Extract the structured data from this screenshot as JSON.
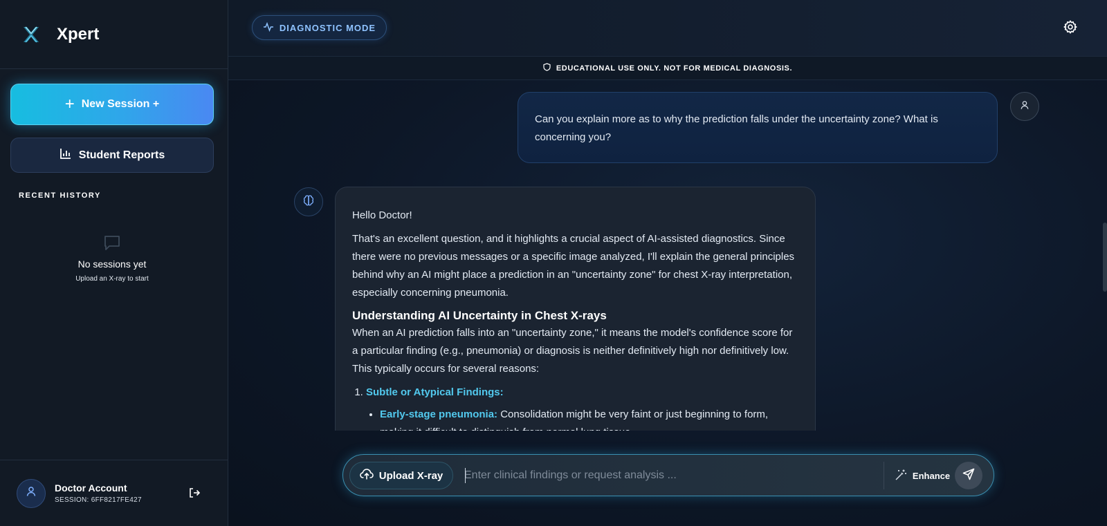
{
  "app": {
    "name": "Xpert"
  },
  "sidebar": {
    "new_session_label": "New Session +",
    "reports_label": "Student Reports",
    "recent_history_title": "RECENT HISTORY",
    "empty_title": "No sessions yet",
    "empty_subtitle": "Upload an X-ray to start"
  },
  "account": {
    "name": "Doctor Account",
    "session": "SESSION: 6FF8217FE427"
  },
  "header": {
    "mode_label": "DIAGNOSTIC MODE",
    "disclaimer": "EDUCATIONAL USE ONLY. NOT FOR MEDICAL DIAGNOSIS."
  },
  "chat": {
    "user_message": "Can you explain more as to why the prediction falls under the uncertainty zone? What is concerning you?",
    "bot": {
      "greeting": "Hello Doctor!",
      "intro": "That's an excellent question, and it highlights a crucial aspect of AI-assisted diagnostics. Since there were no previous messages or a specific image analyzed, I'll explain the general principles behind why an AI might place a prediction in an \"uncertainty zone\" for chest X-ray interpretation, especially concerning pneumonia.",
      "heading": "Understanding AI Uncertainty in Chest X-rays",
      "explanation": "When an AI prediction falls into an \"uncertainty zone,\" it means the model's confidence score for a particular finding (e.g., pneumonia) or diagnosis is neither definitively high nor definitively low. This typically occurs for several reasons:",
      "list_item_1": "Subtle or Atypical Findings:",
      "sub_item_1_label": "Early-stage pneumonia:",
      "sub_item_1_text": "Consolidation might be very faint or just beginning to form, making it difficult to distinguish from normal lung tissue."
    }
  },
  "composer": {
    "upload_label": "Upload X-ray",
    "placeholder": "Enter clinical findings or request analysis ...",
    "value": "",
    "enhance_label": "Enhance"
  },
  "colors": {
    "accent_cyan": "#52c9ee",
    "new_session_gradient_start": "#17bde0",
    "new_session_gradient_end": "#4a88f2",
    "mode_pill_text": "#8fc3ff"
  },
  "icons": {
    "logo": "x-logo-icon",
    "plus": "plus-icon",
    "reports": "bar-chart-icon",
    "empty": "chat-bubble-icon",
    "avatar": "user-icon",
    "logout": "logout-icon",
    "mode": "activity-pulse-icon",
    "settings": "gear-icon",
    "disclaimer": "shield-icon",
    "bot": "brain-icon",
    "upload": "cloud-upload-icon",
    "enhance": "magic-wand-icon",
    "send": "send-icon"
  }
}
